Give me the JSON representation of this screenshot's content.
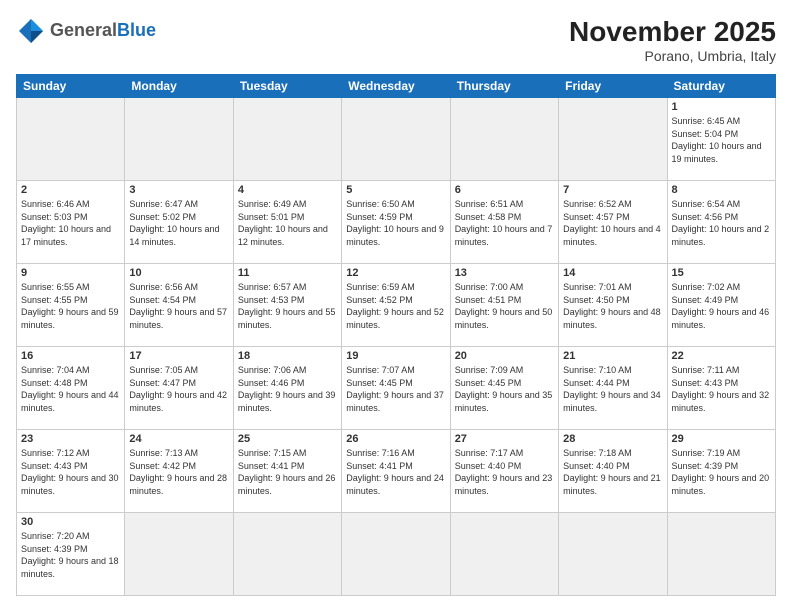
{
  "header": {
    "logo_general": "General",
    "logo_blue": "Blue",
    "month_title": "November 2025",
    "location": "Porano, Umbria, Italy"
  },
  "days_of_week": [
    "Sunday",
    "Monday",
    "Tuesday",
    "Wednesday",
    "Thursday",
    "Friday",
    "Saturday"
  ],
  "weeks": [
    [
      {
        "day": "",
        "empty": true
      },
      {
        "day": "",
        "empty": true
      },
      {
        "day": "",
        "empty": true
      },
      {
        "day": "",
        "empty": true
      },
      {
        "day": "",
        "empty": true
      },
      {
        "day": "",
        "empty": true
      },
      {
        "day": "1",
        "sunrise": "6:45 AM",
        "sunset": "5:04 PM",
        "daylight": "10 hours and 19 minutes."
      }
    ],
    [
      {
        "day": "2",
        "sunrise": "6:46 AM",
        "sunset": "5:03 PM",
        "daylight": "10 hours and 17 minutes."
      },
      {
        "day": "3",
        "sunrise": "6:47 AM",
        "sunset": "5:02 PM",
        "daylight": "10 hours and 14 minutes."
      },
      {
        "day": "4",
        "sunrise": "6:49 AM",
        "sunset": "5:01 PM",
        "daylight": "10 hours and 12 minutes."
      },
      {
        "day": "5",
        "sunrise": "6:50 AM",
        "sunset": "4:59 PM",
        "daylight": "10 hours and 9 minutes."
      },
      {
        "day": "6",
        "sunrise": "6:51 AM",
        "sunset": "4:58 PM",
        "daylight": "10 hours and 7 minutes."
      },
      {
        "day": "7",
        "sunrise": "6:52 AM",
        "sunset": "4:57 PM",
        "daylight": "10 hours and 4 minutes."
      },
      {
        "day": "8",
        "sunrise": "6:54 AM",
        "sunset": "4:56 PM",
        "daylight": "10 hours and 2 minutes."
      }
    ],
    [
      {
        "day": "9",
        "sunrise": "6:55 AM",
        "sunset": "4:55 PM",
        "daylight": "9 hours and 59 minutes."
      },
      {
        "day": "10",
        "sunrise": "6:56 AM",
        "sunset": "4:54 PM",
        "daylight": "9 hours and 57 minutes."
      },
      {
        "day": "11",
        "sunrise": "6:57 AM",
        "sunset": "4:53 PM",
        "daylight": "9 hours and 55 minutes."
      },
      {
        "day": "12",
        "sunrise": "6:59 AM",
        "sunset": "4:52 PM",
        "daylight": "9 hours and 52 minutes."
      },
      {
        "day": "13",
        "sunrise": "7:00 AM",
        "sunset": "4:51 PM",
        "daylight": "9 hours and 50 minutes."
      },
      {
        "day": "14",
        "sunrise": "7:01 AM",
        "sunset": "4:50 PM",
        "daylight": "9 hours and 48 minutes."
      },
      {
        "day": "15",
        "sunrise": "7:02 AM",
        "sunset": "4:49 PM",
        "daylight": "9 hours and 46 minutes."
      }
    ],
    [
      {
        "day": "16",
        "sunrise": "7:04 AM",
        "sunset": "4:48 PM",
        "daylight": "9 hours and 44 minutes."
      },
      {
        "day": "17",
        "sunrise": "7:05 AM",
        "sunset": "4:47 PM",
        "daylight": "9 hours and 42 minutes."
      },
      {
        "day": "18",
        "sunrise": "7:06 AM",
        "sunset": "4:46 PM",
        "daylight": "9 hours and 39 minutes."
      },
      {
        "day": "19",
        "sunrise": "7:07 AM",
        "sunset": "4:45 PM",
        "daylight": "9 hours and 37 minutes."
      },
      {
        "day": "20",
        "sunrise": "7:09 AM",
        "sunset": "4:45 PM",
        "daylight": "9 hours and 35 minutes."
      },
      {
        "day": "21",
        "sunrise": "7:10 AM",
        "sunset": "4:44 PM",
        "daylight": "9 hours and 34 minutes."
      },
      {
        "day": "22",
        "sunrise": "7:11 AM",
        "sunset": "4:43 PM",
        "daylight": "9 hours and 32 minutes."
      }
    ],
    [
      {
        "day": "23",
        "sunrise": "7:12 AM",
        "sunset": "4:43 PM",
        "daylight": "9 hours and 30 minutes."
      },
      {
        "day": "24",
        "sunrise": "7:13 AM",
        "sunset": "4:42 PM",
        "daylight": "9 hours and 28 minutes."
      },
      {
        "day": "25",
        "sunrise": "7:15 AM",
        "sunset": "4:41 PM",
        "daylight": "9 hours and 26 minutes."
      },
      {
        "day": "26",
        "sunrise": "7:16 AM",
        "sunset": "4:41 PM",
        "daylight": "9 hours and 24 minutes."
      },
      {
        "day": "27",
        "sunrise": "7:17 AM",
        "sunset": "4:40 PM",
        "daylight": "9 hours and 23 minutes."
      },
      {
        "day": "28",
        "sunrise": "7:18 AM",
        "sunset": "4:40 PM",
        "daylight": "9 hours and 21 minutes."
      },
      {
        "day": "29",
        "sunrise": "7:19 AM",
        "sunset": "4:39 PM",
        "daylight": "9 hours and 20 minutes."
      }
    ],
    [
      {
        "day": "30",
        "sunrise": "7:20 AM",
        "sunset": "4:39 PM",
        "daylight": "9 hours and 18 minutes."
      },
      {
        "day": "",
        "empty": true
      },
      {
        "day": "",
        "empty": true
      },
      {
        "day": "",
        "empty": true
      },
      {
        "day": "",
        "empty": true
      },
      {
        "day": "",
        "empty": true
      },
      {
        "day": "",
        "empty": true
      }
    ]
  ]
}
